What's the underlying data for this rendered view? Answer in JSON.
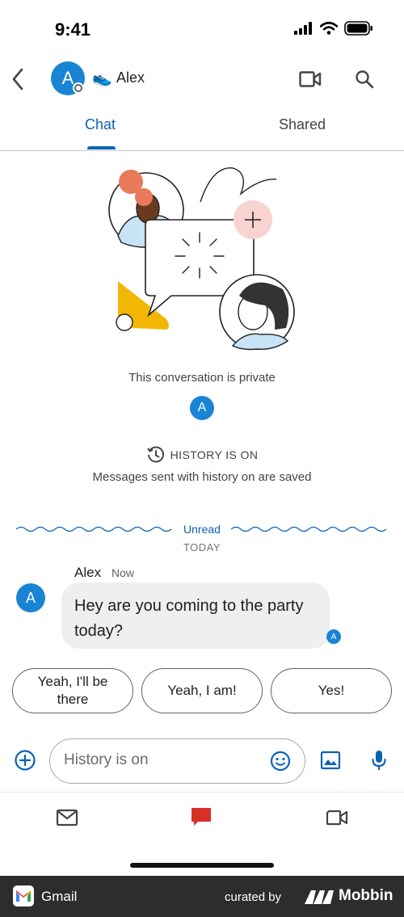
{
  "status_bar": {
    "time": "9:41"
  },
  "header": {
    "contact_name": "Alex",
    "avatar_initial": "A",
    "status_emoji": "👟",
    "icons": {
      "back": "chevron-left-icon",
      "video": "video-camera-icon",
      "search": "search-icon"
    }
  },
  "tabs": [
    {
      "label": "Chat",
      "active": true
    },
    {
      "label": "Shared",
      "active": false
    }
  ],
  "intro": {
    "private_text": "This conversation is private",
    "member_initial": "A",
    "history_label": "HISTORY IS ON",
    "history_sub": "Messages sent with history on are saved"
  },
  "divider": {
    "unread_label": "Unread",
    "date_label": "TODAY"
  },
  "message": {
    "sender": "Alex",
    "time": "Now",
    "avatar_initial": "A",
    "text": "Hey are you coming to the party today?",
    "read_initial": "A"
  },
  "smart_replies": [
    "Yeah, I'll be there",
    "Yeah, I am!",
    "Yes!"
  ],
  "composer": {
    "placeholder": "History is on"
  },
  "bottom_nav": [
    {
      "name": "mail",
      "icon": "mail-icon",
      "active": false
    },
    {
      "name": "chat",
      "icon": "chat-icon",
      "active": true
    },
    {
      "name": "meet",
      "icon": "video-camera-icon",
      "active": false
    }
  ],
  "footer": {
    "app_name": "Gmail",
    "curated_by": "curated by",
    "brand": "Mobbin"
  },
  "colors": {
    "accent": "#0b63b6",
    "avatar": "#1a84d4",
    "chat_active": "#d93025",
    "bubble": "#efefef"
  }
}
